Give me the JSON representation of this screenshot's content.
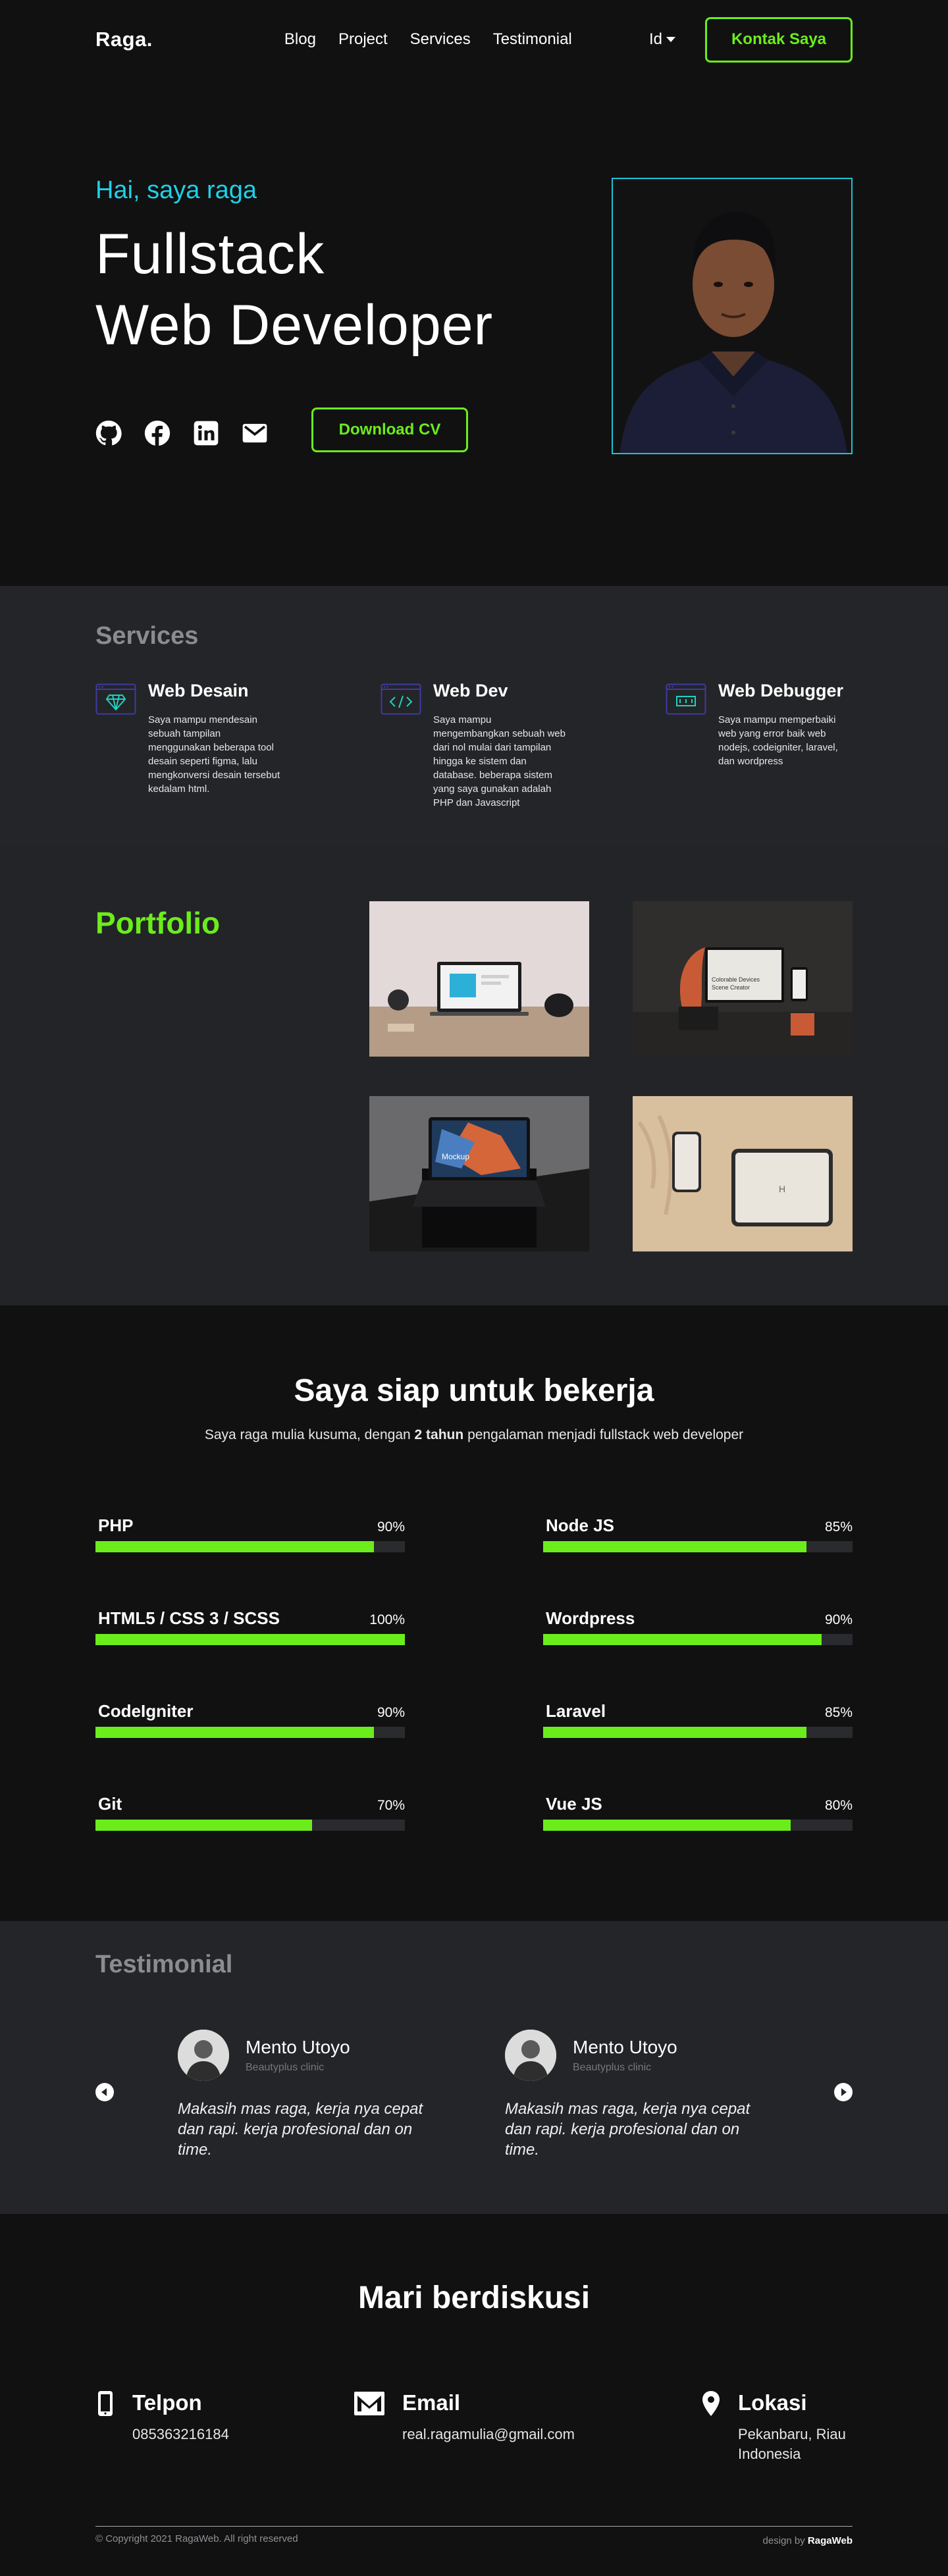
{
  "nav": {
    "logo": "Raga.",
    "links": [
      "Blog",
      "Project",
      "Services",
      "Testimonial"
    ],
    "lang": "Id",
    "contact_button": "Kontak Saya"
  },
  "hero": {
    "greeting": "Hai, saya raga",
    "title_line1": "Fullstack",
    "title_line2": "Web Developer",
    "socials": [
      "github-icon",
      "facebook-icon",
      "linkedin-icon",
      "mail-icon"
    ],
    "cv_button": "Download CV"
  },
  "services": {
    "title": "Services",
    "items": [
      {
        "title": "Web Desain",
        "icon": "diamond-window-icon",
        "desc": "Saya mampu mendesain sebuah tampilan menggunakan beberapa tool desain seperti figma, lalu mengkonversi desain tersebut kedalam html."
      },
      {
        "title": "Web Dev",
        "icon": "code-window-icon",
        "desc": "Saya mampu mengembangkan sebuah web dari nol mulai dari tampilan hingga ke sistem dan database. beberapa sistem yang saya gunakan adalah PHP dan Javascript"
      },
      {
        "title": "Web Debugger",
        "icon": "error-window-icon",
        "desc": "Saya mampu memperbaiki web yang error baik web nodejs, codeigniter, laravel, dan wordpress"
      }
    ]
  },
  "portfolio": {
    "title": "Portfolio",
    "thumb2_caption_line1": "Colorable Devices",
    "thumb2_caption_line2": "Scene Creator",
    "thumb3_caption": "Mockup"
  },
  "skills": {
    "title": "Saya siap untuk bekerja",
    "sub_before": "Saya raga mulia kusuma, dengan",
    "sub_bold": "2 tahun",
    "sub_after": "pengalaman menjadi fullstack web developer",
    "items": [
      {
        "name": "PHP",
        "pct": "90%",
        "value": 90
      },
      {
        "name": "Node JS",
        "pct": "85%",
        "value": 85
      },
      {
        "name": "HTML5 / CSS 3 / SCSS",
        "pct": "100%",
        "value": 100
      },
      {
        "name": "Wordpress",
        "pct": "90%",
        "value": 90
      },
      {
        "name": "CodeIgniter",
        "pct": "90%",
        "value": 90
      },
      {
        "name": "Laravel",
        "pct": "85%",
        "value": 85
      },
      {
        "name": "Git",
        "pct": "70%",
        "value": 70
      },
      {
        "name": "Vue JS",
        "pct": "80%",
        "value": 80
      }
    ]
  },
  "testimonial": {
    "title": "Testimonial",
    "cards": [
      {
        "name": "Mento Utoyo",
        "role": "Beautyplus clinic",
        "quote": "Makasih mas raga, kerja nya cepat dan rapi. kerja profesional dan on time."
      },
      {
        "name": "Mento Utoyo",
        "role": "Beautyplus clinic",
        "quote": "Makasih mas raga, kerja nya cepat dan rapi. kerja profesional dan on time."
      }
    ]
  },
  "contact": {
    "title": "Mari berdiskusi",
    "items": [
      {
        "label": "Telpon",
        "value": "085363216184",
        "icon": "phone-icon"
      },
      {
        "label": "Email",
        "value": "real.ragamulia@gmail.com",
        "icon": "mail-icon"
      },
      {
        "label": "Lokasi",
        "value_line1": "Pekanbaru, Riau",
        "value_line2": "Indonesia",
        "icon": "location-pin-icon"
      }
    ]
  },
  "footer": {
    "copyright": "© Copyright 2021 RagaWeb. All right reserved",
    "design_prefix": "design by",
    "design_brand": "RagaWeb"
  },
  "colors": {
    "accent_green": "#6bed1b",
    "accent_cyan": "#1ed1e6",
    "bg_dark": "#111112",
    "bg_panel": "#242528"
  }
}
